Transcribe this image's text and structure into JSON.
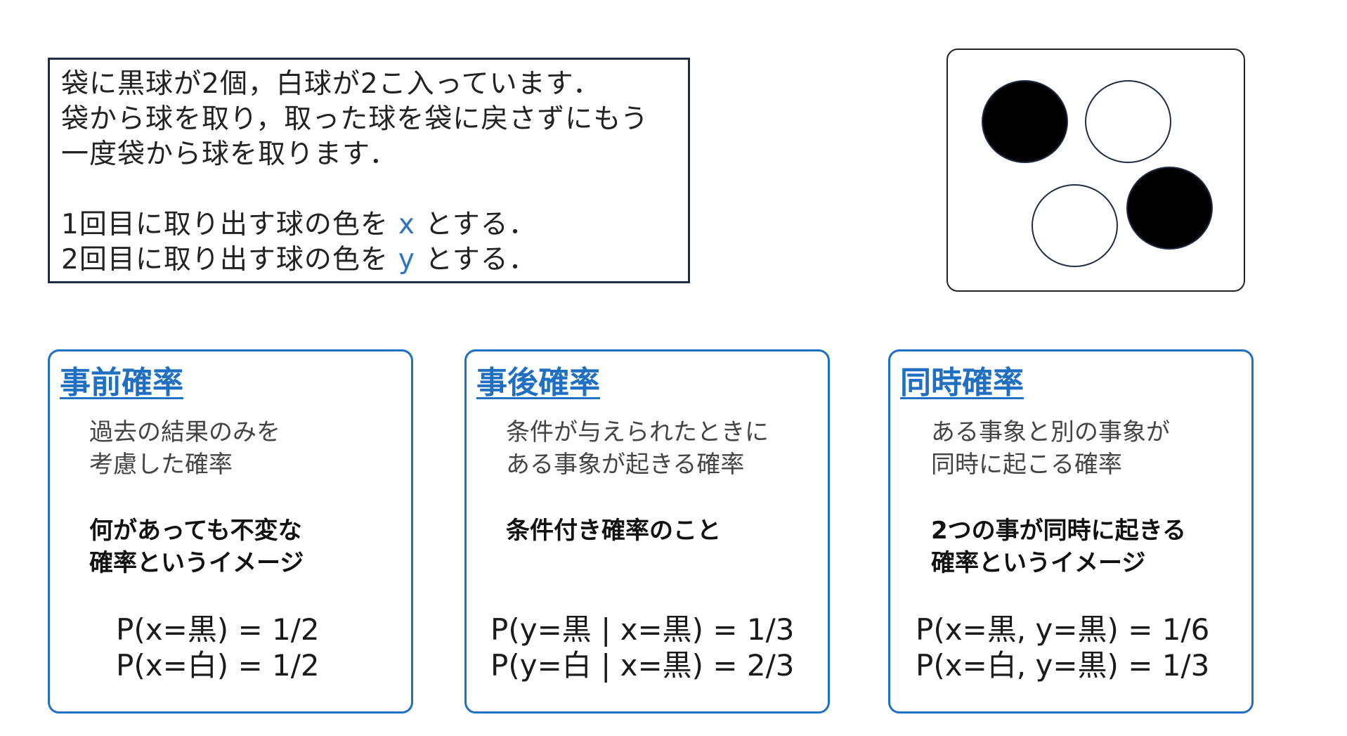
{
  "problem": {
    "lines": [
      "袋に黒球が2個，白球が2こ入っています．",
      "袋から球を取り，取った球を袋に戻さずにもう",
      "一度袋から球を取ります．"
    ],
    "x_line": {
      "before": "1回目に取り出す球の色を",
      "var": "x",
      "after": "とする．"
    },
    "y_line": {
      "before": "2回目に取り出す球の色を",
      "var": "y",
      "after": "とする．"
    },
    "var_color": "#2e74c0"
  },
  "bag": {
    "balls": [
      "black",
      "white",
      "white",
      "black"
    ]
  },
  "cards": [
    {
      "title": "事前確率",
      "desc": [
        "過去の結果のみを",
        "考慮した確率"
      ],
      "emph": [
        "何があっても不変な",
        "確率というイメージ"
      ],
      "formulas": [
        "P(x=黒) = 1/2",
        "P(x=白) = 1/2"
      ]
    },
    {
      "title": "事後確率",
      "desc": [
        "条件が与えられたときに",
        "ある事象が起きる確率"
      ],
      "emph": [
        "条件付き確率のこと",
        ""
      ],
      "formulas": [
        "P(y=黒 | x=黒) = 1/3",
        "P(y=白 | x=黒) = 2/3"
      ]
    },
    {
      "title": "同時確率",
      "desc": [
        "ある事象と別の事象が",
        "同時に起こる確率"
      ],
      "emph": [
        "2つの事が同時に起きる",
        "確率というイメージ"
      ],
      "formulas": [
        "P(x=黒, y=黒) = 1/6",
        "P(x=白, y=黒) = 1/3"
      ]
    }
  ],
  "colors": {
    "accent": "#1f6fc2",
    "problem_border": "#1e2d44"
  }
}
